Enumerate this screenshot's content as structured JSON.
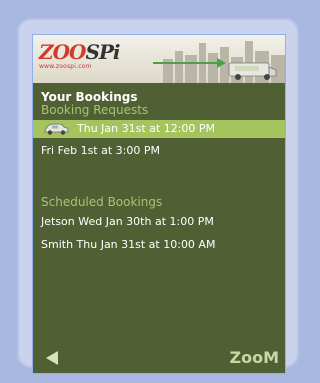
{
  "banner": {
    "logo_text_a": "ZOO",
    "logo_text_b": "SPi",
    "tagline": "www.zoospi.com"
  },
  "page_title": "Your Bookings",
  "requests": {
    "heading": "Booking Requests",
    "items": [
      {
        "label": "Thu Jan 31st at 12:00 PM",
        "icon": "car-icon",
        "selected": true
      },
      {
        "label": "Fri Feb 1st at 3:00 PM",
        "selected": false
      }
    ]
  },
  "scheduled": {
    "heading": "Scheduled Bookings",
    "items": [
      {
        "label": "Jetson Wed Jan 30th at 1:00 PM"
      },
      {
        "label": "Smith Thu Jan 31st at 10:00 AM"
      }
    ]
  },
  "footer": {
    "back_icon": "back-arrow-icon",
    "brand": "ZooM"
  },
  "colors": {
    "screen_bg": "#516034",
    "accent": "#a6c46f",
    "selected_bg": "#a6c45e",
    "frame": "#c9d3ee"
  }
}
